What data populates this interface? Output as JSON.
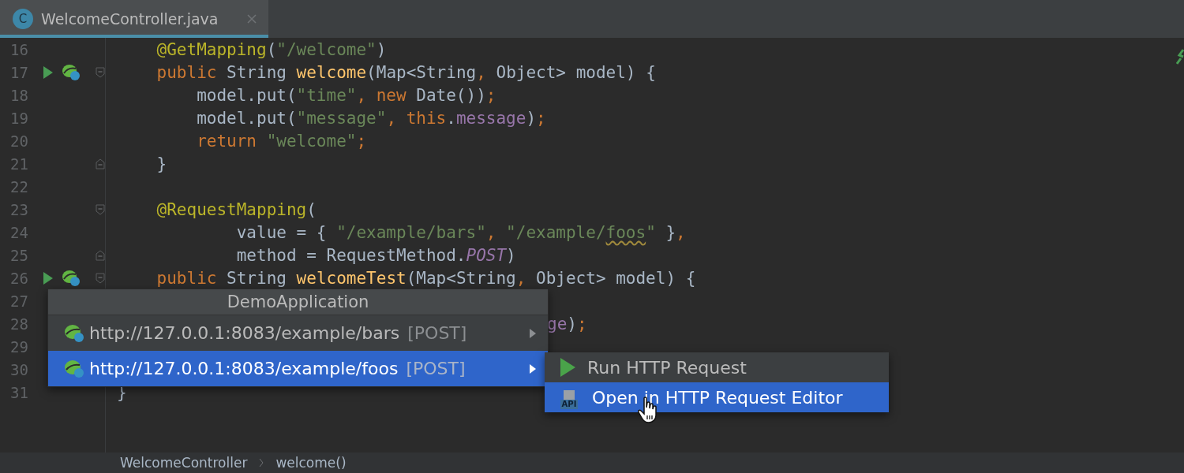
{
  "tab": {
    "title": "WelcomeController.java",
    "icon_letter": "C",
    "selected": true
  },
  "code_lines": [
    {
      "number": "16",
      "run": false,
      "tokens": [
        {
          "t": "    @GetMapping",
          "kind": "ann"
        },
        {
          "t": "(",
          "kind": "plain"
        },
        {
          "t": "\"/welcome\"",
          "kind": "str"
        },
        {
          "t": ")",
          "kind": "plain"
        }
      ]
    },
    {
      "number": "17",
      "run": true,
      "fold": {
        "kind": "start"
      },
      "tokens": [
        {
          "t": "    public",
          "kind": "kw"
        },
        {
          "t": " String ",
          "kind": "plain"
        },
        {
          "t": "welcome",
          "kind": "fn"
        },
        {
          "t": "(Map<String",
          "kind": "plain"
        },
        {
          "t": ",",
          "kind": "kw"
        },
        {
          "t": " Object> model) {",
          "kind": "plain"
        }
      ]
    },
    {
      "number": "18",
      "run": false,
      "tokens": [
        {
          "t": "        model.put(",
          "kind": "plain"
        },
        {
          "t": "\"time\"",
          "kind": "str"
        },
        {
          "t": ", new",
          "kind": "kw"
        },
        {
          "t": " Date())",
          "kind": "plain"
        },
        {
          "t": ";",
          "kind": "kw"
        }
      ]
    },
    {
      "number": "19",
      "run": false,
      "tokens": [
        {
          "t": "        model.put(",
          "kind": "plain"
        },
        {
          "t": "\"message\"",
          "kind": "str"
        },
        {
          "t": ", this",
          "kind": "kw"
        },
        {
          "t": ".",
          "kind": "plain"
        },
        {
          "t": "message",
          "kind": "field"
        },
        {
          "t": ")",
          "kind": "plain"
        },
        {
          "t": ";",
          "kind": "kw"
        }
      ]
    },
    {
      "number": "20",
      "run": false,
      "tokens": [
        {
          "t": "        return",
          "kind": "kw"
        },
        {
          "t": " \"welcome\"",
          "kind": "str"
        },
        {
          "t": ";",
          "kind": "kw"
        }
      ]
    },
    {
      "number": "21",
      "run": false,
      "fold": {
        "kind": "end"
      },
      "tokens": [
        {
          "t": "    }",
          "kind": "plain"
        }
      ]
    },
    {
      "number": "22",
      "run": false
    },
    {
      "number": "23",
      "run": false,
      "fold": {
        "kind": "start"
      },
      "tokens": [
        {
          "t": "    @RequestMapping",
          "kind": "ann"
        },
        {
          "t": "(",
          "kind": "plain"
        }
      ]
    },
    {
      "number": "24",
      "run": false,
      "tokens": [
        {
          "t": "            value = { ",
          "kind": "plain"
        },
        {
          "t": "\"/example/bars\"",
          "kind": "str"
        },
        {
          "t": ",",
          "kind": "kw"
        },
        {
          "t": " \"/example/",
          "kind": "str"
        },
        {
          "t": "foos",
          "kind": "str",
          "warning": true
        },
        {
          "t": "\"",
          "kind": "str"
        },
        {
          "t": " }",
          "kind": "plain"
        },
        {
          "t": ",",
          "kind": "kw"
        }
      ]
    },
    {
      "number": "25",
      "run": false,
      "fold": {
        "kind": "end"
      },
      "tokens": [
        {
          "t": "            method = RequestMethod.",
          "kind": "plain"
        },
        {
          "t": "POST",
          "kind": "const"
        },
        {
          "t": ")",
          "kind": "plain"
        }
      ]
    },
    {
      "number": "26",
      "run": true,
      "fold": {
        "kind": "start"
      },
      "tokens": [
        {
          "t": "    public",
          "kind": "kw"
        },
        {
          "t": " String ",
          "kind": "plain"
        },
        {
          "t": "welcomeTest",
          "kind": "fn"
        },
        {
          "t": "(Map<String",
          "kind": "plain"
        },
        {
          "t": ",",
          "kind": "kw"
        },
        {
          "t": " Object> model) {",
          "kind": "plain"
        }
      ]
    },
    {
      "number": "27",
      "run": false
    },
    {
      "number": "28",
      "run": false,
      "kind": "covered",
      "tokens": [
        {
          "t": "ge",
          "kind": "field"
        },
        {
          "t": ")",
          "kind": "plain"
        },
        {
          "t": ";",
          "kind": "kw"
        }
      ]
    },
    {
      "number": "29",
      "run": false
    },
    {
      "number": "30",
      "run": false
    },
    {
      "number": "31",
      "run": false,
      "tokens": [
        {
          "t": "}",
          "kind": "plain"
        }
      ]
    }
  ],
  "popup": {
    "title": "DemoApplication",
    "items": [
      {
        "url": "http://127.0.0.1:8083/example/bars",
        "method": "[POST]",
        "selected": false
      },
      {
        "url": "http://127.0.0.1:8083/example/foos",
        "method": "[POST]",
        "selected": true
      }
    ]
  },
  "submenu": {
    "items": [
      {
        "label": "Run HTTP Request",
        "kind": "run",
        "selected": false
      },
      {
        "label": "Open in HTTP Request Editor",
        "kind": "api",
        "icon_label": "API",
        "selected": true
      }
    ]
  },
  "breadcrumb": [
    "WelcomeController",
    "welcome()"
  ]
}
